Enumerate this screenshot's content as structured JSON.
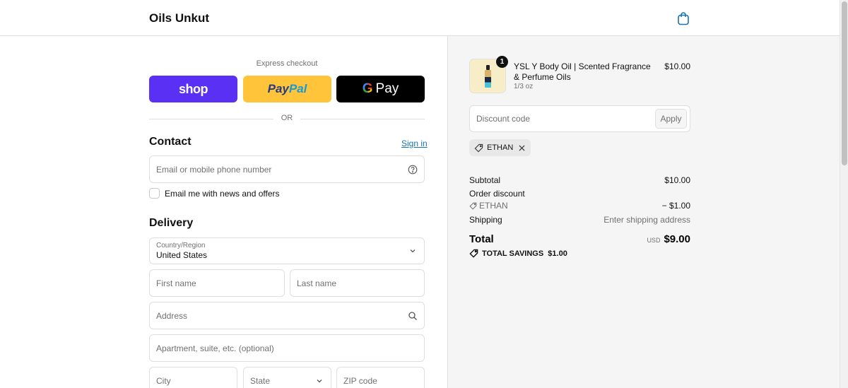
{
  "header": {
    "brand": "Oils Unkut"
  },
  "express": {
    "label": "Express checkout",
    "shop_label": "shop",
    "paypal_part1": "Pay",
    "paypal_part2": "Pal",
    "gpay_g": "G",
    "gpay_label": "Pay",
    "or_label": "OR"
  },
  "contact": {
    "title": "Contact",
    "signin_label": "Sign in",
    "email_placeholder": "Email or mobile phone number",
    "newsletter_label": "Email me with news and offers"
  },
  "delivery": {
    "title": "Delivery",
    "country_label": "Country/Region",
    "country_value": "United States",
    "first_name_placeholder": "First name",
    "last_name_placeholder": "Last name",
    "address_placeholder": "Address",
    "apartment_placeholder": "Apartment, suite, etc. (optional)",
    "city_placeholder": "City",
    "state_placeholder": "State",
    "zip_placeholder": "ZIP code"
  },
  "cart": {
    "item": {
      "quantity": "1",
      "name": "YSL Y Body Oil | Scented Fragrance & Perfume Oils",
      "variant": "1/3 oz",
      "price": "$10.00"
    },
    "discount_placeholder": "Discount code",
    "apply_label": "Apply",
    "applied_code": "ETHAN",
    "subtotal_label": "Subtotal",
    "subtotal_value": "$10.00",
    "order_discount_label": "Order discount",
    "discount_code_label": "ETHAN",
    "discount_value": "− $1.00",
    "shipping_label": "Shipping",
    "shipping_value": "Enter shipping address",
    "total_label": "Total",
    "currency": "USD",
    "total_value": "$9.00",
    "savings_label": "TOTAL SAVINGS  $1.00"
  },
  "colors": {
    "shop_purple": "#5a31f4",
    "paypal_yellow": "#ffc439",
    "link_blue": "#1773b0"
  }
}
